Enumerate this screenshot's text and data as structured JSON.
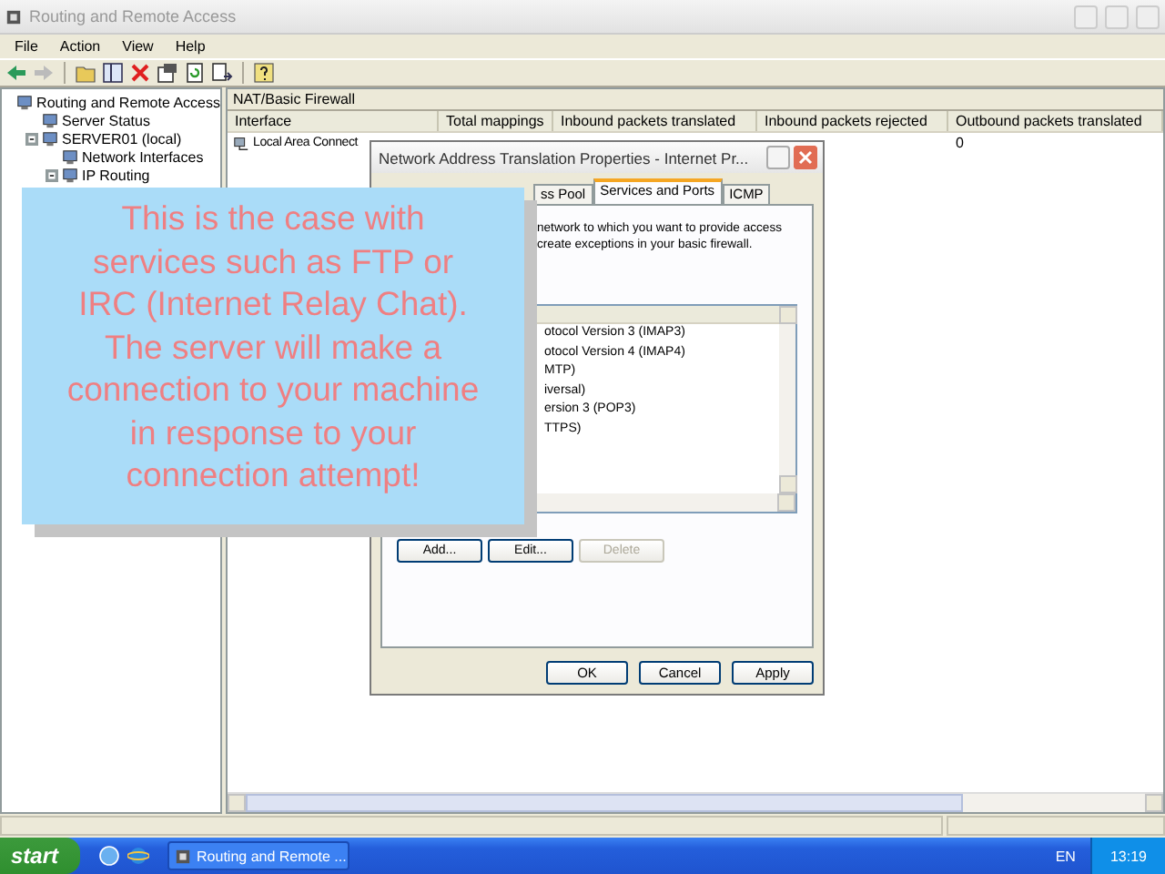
{
  "window": {
    "title": "Routing and Remote Access"
  },
  "menu": [
    "File",
    "Action",
    "View",
    "Help"
  ],
  "tree": [
    {
      "label": "Routing and Remote Access",
      "children": [
        {
          "label": "Server Status"
        },
        {
          "label": "SERVER01 (local)",
          "expanded": true,
          "children": [
            {
              "label": "Network Interfaces"
            },
            {
              "label": "IP Routing",
              "expanded": true
            }
          ]
        }
      ]
    }
  ],
  "details": {
    "title": "NAT/Basic Firewall",
    "columns": [
      "Interface",
      "Total mappings",
      "Inbound packets translated",
      "Inbound packets rejected",
      "Outbound packets translated"
    ],
    "rows": [
      {
        "interface": "Local Area Connect",
        "outbound_packets_translated": "0"
      }
    ]
  },
  "dialog": {
    "title": "Network Address Translation Properties - Internet Pr...",
    "tabs": [
      {
        "label": "ss Pool",
        "selected": false
      },
      {
        "label": "Services and Ports",
        "selected": true
      },
      {
        "label": "ICMP",
        "selected": false
      }
    ],
    "description": [
      "network to which you want to provide access",
      "create exceptions in your basic firewall."
    ],
    "services": [
      "otocol Version 3 (IMAP3)",
      "otocol Version 4 (IMAP4)",
      "MTP)",
      "iversal)",
      "ersion 3 (POP3)",
      "TTPS)"
    ],
    "buttons": [
      {
        "label": "Add...",
        "disabled": false
      },
      {
        "label": "Edit...",
        "disabled": false
      },
      {
        "label": "Delete",
        "disabled": true
      }
    ],
    "footer": [
      "OK",
      "Cancel",
      "Apply"
    ]
  },
  "callout": {
    "text": "This is the case with\nservices such as FTP or\nIRC (Internet Relay Chat).\nThe server will make a\nconnection to your machine\nin response to your\nconnection attempt!"
  },
  "taskbar": {
    "start": "start",
    "task": "Routing and Remote ...",
    "language": "EN",
    "clock": "13:19"
  }
}
